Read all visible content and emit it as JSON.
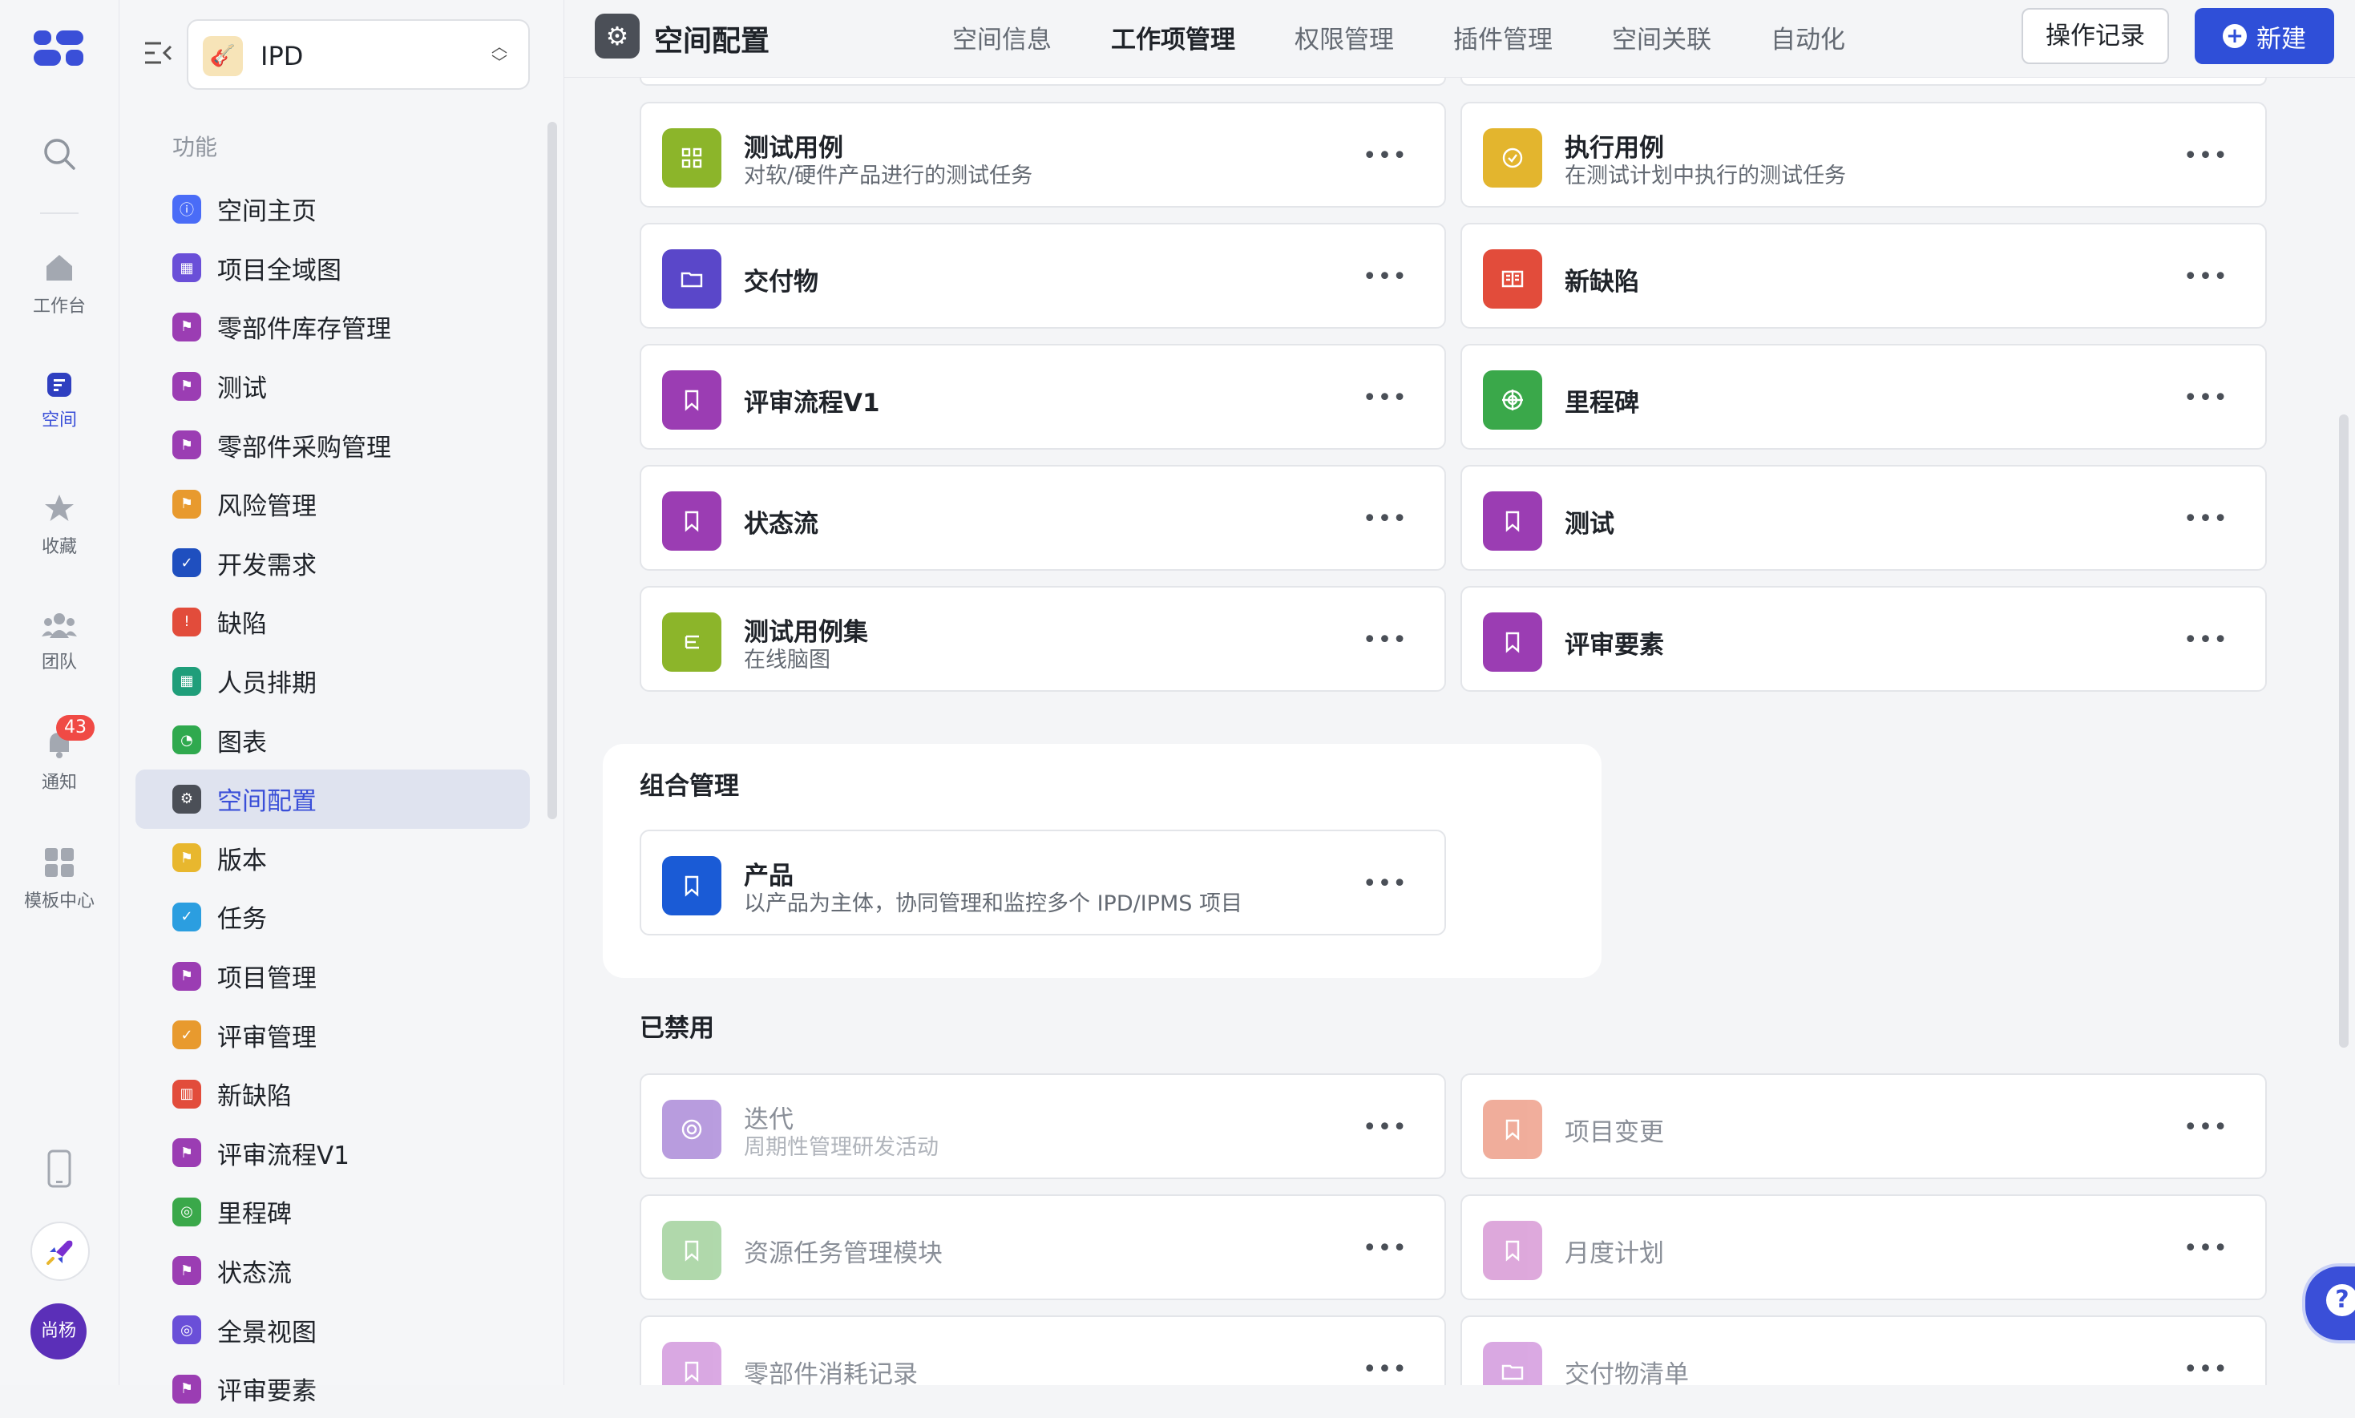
{
  "rail": {
    "items": [
      {
        "label": "工作台",
        "icon": "home-icon"
      },
      {
        "label": "空间",
        "icon": "space-icon"
      },
      {
        "label": "收藏",
        "icon": "star-icon"
      },
      {
        "label": "团队",
        "icon": "team-icon"
      },
      {
        "label": "通知",
        "icon": "bell-icon"
      },
      {
        "label": "模板中心",
        "icon": "template-icon"
      }
    ],
    "notification_count": "43",
    "avatar_text": "尚杨"
  },
  "sidebar": {
    "space_name": "IPD",
    "group_title": "功能",
    "items": [
      {
        "label": "空间主页",
        "color": "#4a6cf7",
        "glyph": "ⓘ"
      },
      {
        "label": "项目全域图",
        "color": "#6a4fd8",
        "glyph": "▦"
      },
      {
        "label": "零部件库存管理",
        "color": "#9b3db3",
        "glyph": "⚑"
      },
      {
        "label": "测试",
        "color": "#9b3db3",
        "glyph": "⚑"
      },
      {
        "label": "零部件采购管理",
        "color": "#9b3db3",
        "glyph": "⚑"
      },
      {
        "label": "风险管理",
        "color": "#e89a2e",
        "glyph": "⚑"
      },
      {
        "label": "开发需求",
        "color": "#1f4fbf",
        "glyph": "✓"
      },
      {
        "label": "缺陷",
        "color": "#e24c3b",
        "glyph": "!"
      },
      {
        "label": "人员排期",
        "color": "#1f9e7a",
        "glyph": "▦"
      },
      {
        "label": "图表",
        "color": "#2fa94e",
        "glyph": "◔"
      },
      {
        "label": "空间配置",
        "color": "#4b4f57",
        "glyph": "⚙"
      },
      {
        "label": "版本",
        "color": "#e8b72e",
        "glyph": "⚑"
      },
      {
        "label": "任务",
        "color": "#2b9ee0",
        "glyph": "✓"
      },
      {
        "label": "项目管理",
        "color": "#9b3db3",
        "glyph": "⚑"
      },
      {
        "label": "评审管理",
        "color": "#e89a2e",
        "glyph": "✓"
      },
      {
        "label": "新缺陷",
        "color": "#e24c3b",
        "glyph": "▥"
      },
      {
        "label": "评审流程V1",
        "color": "#9b3db3",
        "glyph": "⚑"
      },
      {
        "label": "里程碑",
        "color": "#3aa84a",
        "glyph": "◎"
      },
      {
        "label": "状态流",
        "color": "#9b3db3",
        "glyph": "⚑"
      },
      {
        "label": "全景视图",
        "color": "#6a4fd8",
        "glyph": "◎"
      },
      {
        "label": "评审要素",
        "color": "#9b3db3",
        "glyph": "⚑"
      }
    ],
    "active_index": 10
  },
  "header": {
    "title": "空间配置",
    "tabs": [
      "空间信息",
      "工作项管理",
      "权限管理",
      "插件管理",
      "空间关联",
      "自动化"
    ],
    "active_tab": 1,
    "log_button": "操作记录",
    "new_button": "新建"
  },
  "work_items": [
    {
      "name": "测试用例",
      "desc": "对软/硬件产品进行的测试任务",
      "color": "#8cb52a",
      "icon": "grid-icon"
    },
    {
      "name": "执行用例",
      "desc": "在测试计划中执行的测试任务",
      "color": "#e3b52e",
      "icon": "check-circle-icon"
    },
    {
      "name": "交付物",
      "desc": "",
      "color": "#5a47c9",
      "icon": "folder-icon"
    },
    {
      "name": "新缺陷",
      "desc": "",
      "color": "#e24c3b",
      "icon": "book-icon"
    },
    {
      "name": "评审流程V1",
      "desc": "",
      "color": "#9b3db3",
      "icon": "bookmark-icon"
    },
    {
      "name": "里程碑",
      "desc": "",
      "color": "#3aa84a",
      "icon": "target-icon"
    },
    {
      "name": "状态流",
      "desc": "",
      "color": "#9b3db3",
      "icon": "bookmark-icon"
    },
    {
      "name": "测试",
      "desc": "",
      "color": "#9b3db3",
      "icon": "bookmark-icon"
    },
    {
      "name": "测试用例集",
      "desc": "在线脑图",
      "color": "#8cb52a",
      "icon": "mindmap-icon"
    },
    {
      "name": "评审要素",
      "desc": "",
      "color": "#9b3db3",
      "icon": "bookmark-icon"
    }
  ],
  "combo": {
    "title": "组合管理",
    "item": {
      "name": "产品",
      "desc": "以产品为主体，协同管理和监控多个 IPD/IPMS 项目",
      "color": "#1a5bd6",
      "icon": "bookmark-icon"
    }
  },
  "disabled": {
    "title": "已禁用",
    "items": [
      {
        "name": "迭代",
        "desc": "周期性管理研发活动",
        "color": "#8a5cc9",
        "icon": "cycle-icon"
      },
      {
        "name": "项目变更",
        "desc": "",
        "color": "#e7785a",
        "icon": "bookmark-icon"
      },
      {
        "name": "资源任务管理模块",
        "desc": "",
        "color": "#7cbf74",
        "icon": "bookmark-icon"
      },
      {
        "name": "月度计划",
        "desc": "",
        "color": "#c86fc4",
        "icon": "bookmark-icon"
      },
      {
        "name": "零部件消耗记录",
        "desc": "",
        "color": "#c16fd0",
        "icon": "bookmark-icon"
      },
      {
        "name": "交付物清单",
        "desc": "",
        "color": "#c16fd0",
        "icon": "folder-icon"
      }
    ]
  },
  "more_glyph": "•••"
}
